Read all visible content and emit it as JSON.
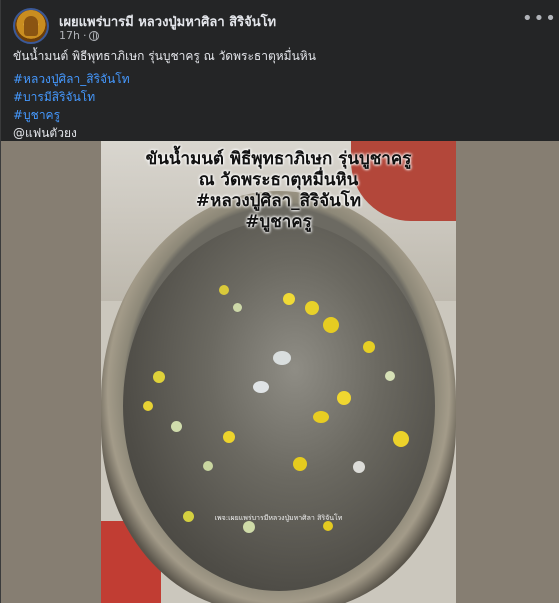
{
  "post": {
    "page_name": "เผยแพร่บารมี หลวงปู่มหาศิลา สิริจันโท",
    "timestamp": "17h",
    "more_label": "•••",
    "caption": "ขันน้ำมนต์ พิธีพุทธาภิเษก รุ่นบูชาครู  ณ วัดพระธาตุหมื่นหิน",
    "hashtags": [
      "#หลวงปู่ศิลา_สิริจันโท",
      "#บารมีสิริจันโท",
      "#บูชาครู"
    ],
    "mention": "@แฟนตัวยง"
  },
  "photo": {
    "overlay_lines": [
      "ขันน้ำมนต์ พิธีพุทธาภิเษก รุ่นบูชาครู",
      "ณ วัดพระธาตุหมื่นหิน",
      "#หลวงปู่ศิลา_สิริจันโท",
      "#บูชาครู"
    ],
    "watermark": "เพจ:เผยแพร่บารมีหลวงปู่มหาศิลา สิริจันโท"
  },
  "colors": {
    "background": "#242526",
    "text": "#e4e6eb",
    "secondary_text": "#b0b3b8",
    "hashtag": "#4599ff"
  },
  "icons": [
    "avatar",
    "globe-icon",
    "more-icon"
  ]
}
